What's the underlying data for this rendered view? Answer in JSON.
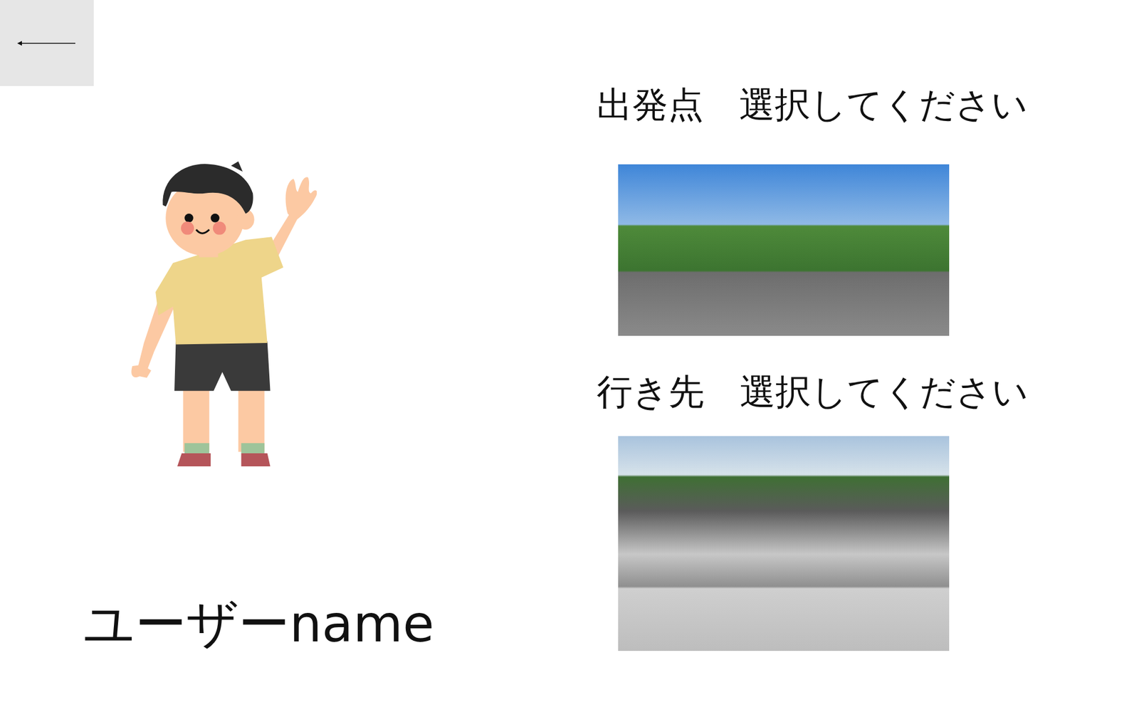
{
  "user": {
    "name": "ユーザーname"
  },
  "origin": {
    "prompt": "出発点　選択してください"
  },
  "destination": {
    "prompt": "行き先　選択してください"
  }
}
